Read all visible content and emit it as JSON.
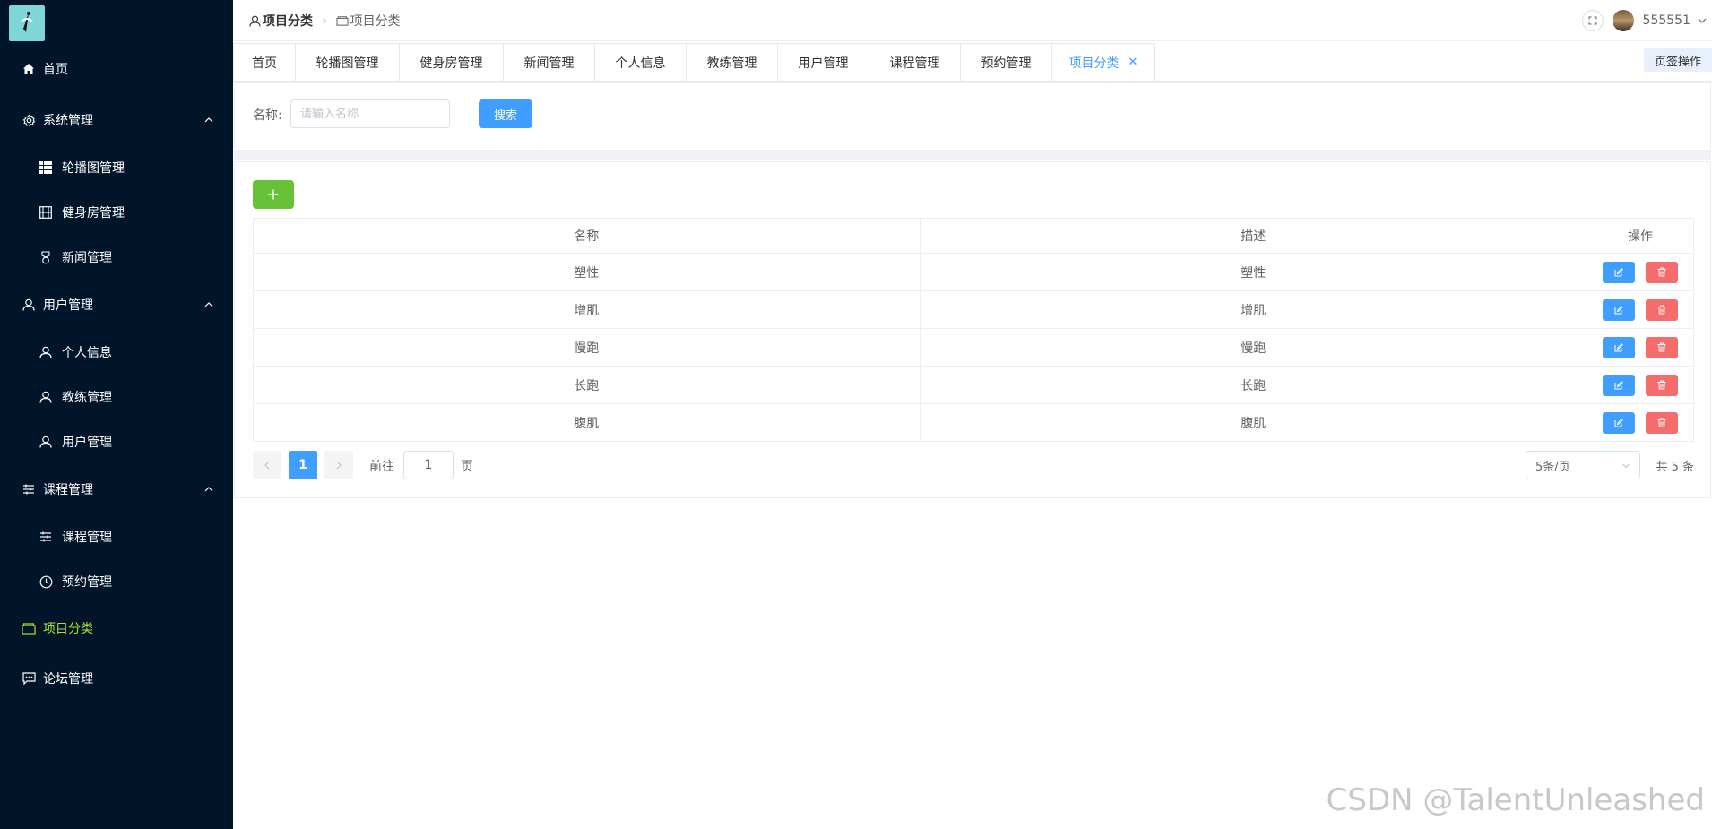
{
  "sidebar": {
    "items": [
      {
        "label": "首页",
        "icon": "home-icon"
      },
      {
        "label": "系统管理",
        "icon": "gear-icon",
        "expanded": true
      },
      {
        "label": "轮播图管理",
        "icon": "grid-icon"
      },
      {
        "label": "健身房管理",
        "icon": "film-icon"
      },
      {
        "label": "新闻管理",
        "icon": "medal-icon"
      },
      {
        "label": "用户管理",
        "icon": "user-icon",
        "expanded": true
      },
      {
        "label": "个人信息",
        "icon": "user-icon"
      },
      {
        "label": "教练管理",
        "icon": "user-icon"
      },
      {
        "label": "用户管理",
        "icon": "user-icon"
      },
      {
        "label": "课程管理",
        "icon": "sliders-icon",
        "expanded": true
      },
      {
        "label": "课程管理",
        "icon": "sliders-icon"
      },
      {
        "label": "预约管理",
        "icon": "clock-icon"
      },
      {
        "label": "项目分类",
        "icon": "folder-icon",
        "active": true
      },
      {
        "label": "论坛管理",
        "icon": "chat-icon"
      }
    ]
  },
  "header": {
    "breadcrumb": [
      "项目分类",
      "项目分类"
    ],
    "username": "555551"
  },
  "tabs": {
    "items": [
      "首页",
      "轮播图管理",
      "健身房管理",
      "新闻管理",
      "个人信息",
      "教练管理",
      "用户管理",
      "课程管理",
      "预约管理",
      "项目分类"
    ],
    "active_index": 9,
    "ops_label": "页签操作"
  },
  "search": {
    "label": "名称:",
    "placeholder": "请输入名称",
    "value": "",
    "button": "搜索"
  },
  "table": {
    "columns": [
      "名称",
      "描述",
      "操作"
    ],
    "rows": [
      {
        "name": "塑性",
        "desc": "塑性"
      },
      {
        "name": "增肌",
        "desc": "增肌"
      },
      {
        "name": "慢跑",
        "desc": "慢跑"
      },
      {
        "name": "长跑",
        "desc": "长跑"
      },
      {
        "name": "腹肌",
        "desc": "腹肌"
      }
    ]
  },
  "pagination": {
    "current_page": "1",
    "goto_label": "前往",
    "goto_value": "1",
    "page_unit": "页",
    "page_size": "5条/页",
    "total": "共 5 条"
  },
  "watermark": "CSDN @TalentUnleashed",
  "colors": {
    "sidebar_bg": "#001529",
    "primary": "#409eff",
    "success": "#67c23a",
    "danger": "#f56c6c",
    "active_menu": "#aee22f"
  }
}
